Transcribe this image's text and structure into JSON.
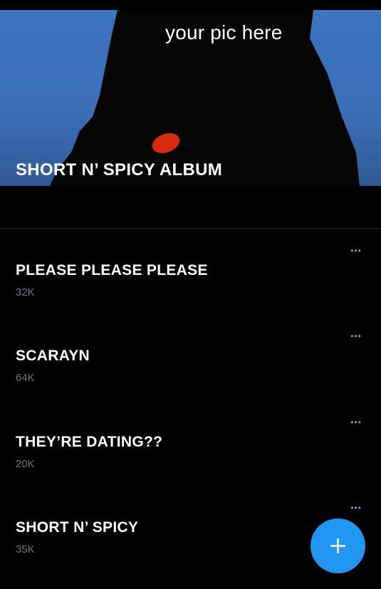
{
  "hero": {
    "caption": "your pic here",
    "title": "SHORT N’ SPICY ALBUM"
  },
  "songs": [
    {
      "title": "PLEASE PLEASE PLEASE",
      "count": "32K"
    },
    {
      "title": "SCARAYN",
      "count": "64K"
    },
    {
      "title": "THEY’RE DATING??",
      "count": "20K"
    },
    {
      "title": "SHORT N’ SPICY",
      "count": "35K"
    }
  ],
  "more_glyph": "•••",
  "fab": {
    "icon": "plus-icon",
    "color": "#2196f3"
  },
  "colors": {
    "background": "#000000",
    "hero_sky": "#3d73bf",
    "accent": "#2196f3",
    "secondary_text": "#6f7480"
  }
}
